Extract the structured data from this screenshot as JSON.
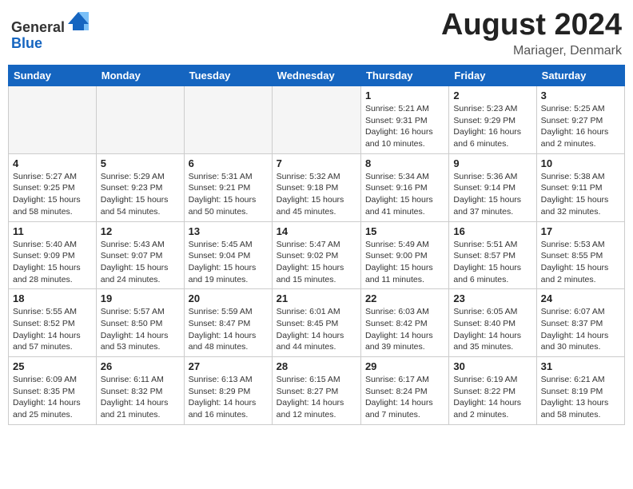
{
  "header": {
    "logo_line1": "General",
    "logo_line2": "Blue",
    "title": "August 2024",
    "location": "Mariager, Denmark"
  },
  "days_of_week": [
    "Sunday",
    "Monday",
    "Tuesday",
    "Wednesday",
    "Thursday",
    "Friday",
    "Saturday"
  ],
  "weeks": [
    [
      {
        "day": "",
        "info": ""
      },
      {
        "day": "",
        "info": ""
      },
      {
        "day": "",
        "info": ""
      },
      {
        "day": "",
        "info": ""
      },
      {
        "day": "1",
        "info": "Sunrise: 5:21 AM\nSunset: 9:31 PM\nDaylight: 16 hours\nand 10 minutes."
      },
      {
        "day": "2",
        "info": "Sunrise: 5:23 AM\nSunset: 9:29 PM\nDaylight: 16 hours\nand 6 minutes."
      },
      {
        "day": "3",
        "info": "Sunrise: 5:25 AM\nSunset: 9:27 PM\nDaylight: 16 hours\nand 2 minutes."
      }
    ],
    [
      {
        "day": "4",
        "info": "Sunrise: 5:27 AM\nSunset: 9:25 PM\nDaylight: 15 hours\nand 58 minutes."
      },
      {
        "day": "5",
        "info": "Sunrise: 5:29 AM\nSunset: 9:23 PM\nDaylight: 15 hours\nand 54 minutes."
      },
      {
        "day": "6",
        "info": "Sunrise: 5:31 AM\nSunset: 9:21 PM\nDaylight: 15 hours\nand 50 minutes."
      },
      {
        "day": "7",
        "info": "Sunrise: 5:32 AM\nSunset: 9:18 PM\nDaylight: 15 hours\nand 45 minutes."
      },
      {
        "day": "8",
        "info": "Sunrise: 5:34 AM\nSunset: 9:16 PM\nDaylight: 15 hours\nand 41 minutes."
      },
      {
        "day": "9",
        "info": "Sunrise: 5:36 AM\nSunset: 9:14 PM\nDaylight: 15 hours\nand 37 minutes."
      },
      {
        "day": "10",
        "info": "Sunrise: 5:38 AM\nSunset: 9:11 PM\nDaylight: 15 hours\nand 32 minutes."
      }
    ],
    [
      {
        "day": "11",
        "info": "Sunrise: 5:40 AM\nSunset: 9:09 PM\nDaylight: 15 hours\nand 28 minutes."
      },
      {
        "day": "12",
        "info": "Sunrise: 5:43 AM\nSunset: 9:07 PM\nDaylight: 15 hours\nand 24 minutes."
      },
      {
        "day": "13",
        "info": "Sunrise: 5:45 AM\nSunset: 9:04 PM\nDaylight: 15 hours\nand 19 minutes."
      },
      {
        "day": "14",
        "info": "Sunrise: 5:47 AM\nSunset: 9:02 PM\nDaylight: 15 hours\nand 15 minutes."
      },
      {
        "day": "15",
        "info": "Sunrise: 5:49 AM\nSunset: 9:00 PM\nDaylight: 15 hours\nand 11 minutes."
      },
      {
        "day": "16",
        "info": "Sunrise: 5:51 AM\nSunset: 8:57 PM\nDaylight: 15 hours\nand 6 minutes."
      },
      {
        "day": "17",
        "info": "Sunrise: 5:53 AM\nSunset: 8:55 PM\nDaylight: 15 hours\nand 2 minutes."
      }
    ],
    [
      {
        "day": "18",
        "info": "Sunrise: 5:55 AM\nSunset: 8:52 PM\nDaylight: 14 hours\nand 57 minutes."
      },
      {
        "day": "19",
        "info": "Sunrise: 5:57 AM\nSunset: 8:50 PM\nDaylight: 14 hours\nand 53 minutes."
      },
      {
        "day": "20",
        "info": "Sunrise: 5:59 AM\nSunset: 8:47 PM\nDaylight: 14 hours\nand 48 minutes."
      },
      {
        "day": "21",
        "info": "Sunrise: 6:01 AM\nSunset: 8:45 PM\nDaylight: 14 hours\nand 44 minutes."
      },
      {
        "day": "22",
        "info": "Sunrise: 6:03 AM\nSunset: 8:42 PM\nDaylight: 14 hours\nand 39 minutes."
      },
      {
        "day": "23",
        "info": "Sunrise: 6:05 AM\nSunset: 8:40 PM\nDaylight: 14 hours\nand 35 minutes."
      },
      {
        "day": "24",
        "info": "Sunrise: 6:07 AM\nSunset: 8:37 PM\nDaylight: 14 hours\nand 30 minutes."
      }
    ],
    [
      {
        "day": "25",
        "info": "Sunrise: 6:09 AM\nSunset: 8:35 PM\nDaylight: 14 hours\nand 25 minutes."
      },
      {
        "day": "26",
        "info": "Sunrise: 6:11 AM\nSunset: 8:32 PM\nDaylight: 14 hours\nand 21 minutes."
      },
      {
        "day": "27",
        "info": "Sunrise: 6:13 AM\nSunset: 8:29 PM\nDaylight: 14 hours\nand 16 minutes."
      },
      {
        "day": "28",
        "info": "Sunrise: 6:15 AM\nSunset: 8:27 PM\nDaylight: 14 hours\nand 12 minutes."
      },
      {
        "day": "29",
        "info": "Sunrise: 6:17 AM\nSunset: 8:24 PM\nDaylight: 14 hours\nand 7 minutes."
      },
      {
        "day": "30",
        "info": "Sunrise: 6:19 AM\nSunset: 8:22 PM\nDaylight: 14 hours\nand 2 minutes."
      },
      {
        "day": "31",
        "info": "Sunrise: 6:21 AM\nSunset: 8:19 PM\nDaylight: 13 hours\nand 58 minutes."
      }
    ]
  ]
}
